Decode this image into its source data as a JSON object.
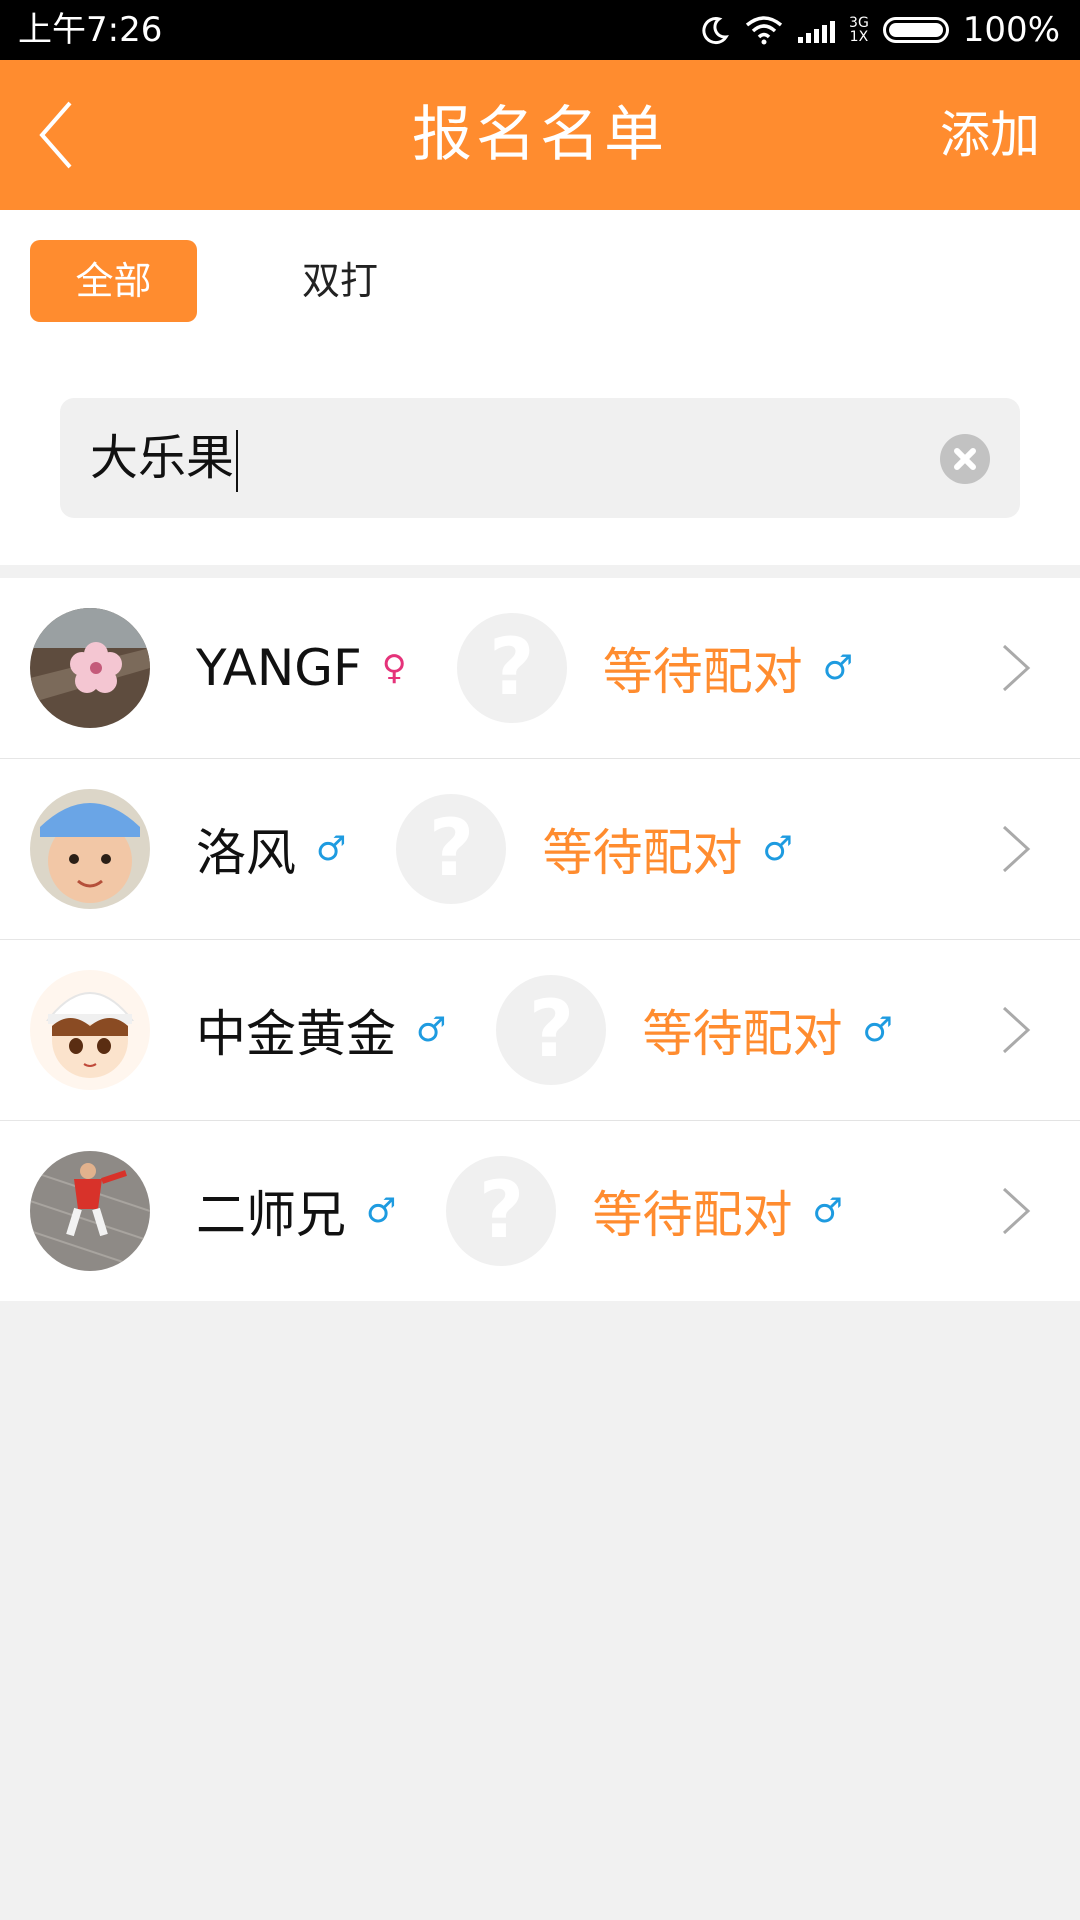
{
  "status_bar": {
    "time": "上午7:26",
    "network_top": "3G",
    "network_bottom": "1X",
    "battery": "100%"
  },
  "app_bar": {
    "title": "报名名单",
    "add_label": "添加",
    "back_icon": "chevron-left-icon",
    "background": "#ff8c2f"
  },
  "filter": {
    "tabs": [
      {
        "label": "全部",
        "selected": true
      },
      {
        "label": "双打",
        "selected": false
      }
    ],
    "search_value": "大乐果"
  },
  "list": {
    "items": [
      {
        "name": "YANGF",
        "gender_symbol": "♀",
        "gender": "female",
        "partner_placeholder": "?",
        "status": "等待配对",
        "partner_gender_symbol": "♂"
      },
      {
        "name": "洛风",
        "gender_symbol": "♂",
        "gender": "male",
        "partner_placeholder": "?",
        "status": "等待配对",
        "partner_gender_symbol": "♂"
      },
      {
        "name": "中金黄金",
        "gender_symbol": "♂",
        "gender": "male",
        "partner_placeholder": "?",
        "status": "等待配对",
        "partner_gender_symbol": "♂"
      },
      {
        "name": "二师兄",
        "gender_symbol": "♂",
        "gender": "male",
        "partner_placeholder": "?",
        "status": "等待配对",
        "partner_gender_symbol": "♂"
      }
    ]
  },
  "colors": {
    "accent": "#ff8c2f",
    "female": "#e5337a",
    "male": "#1e9be0"
  }
}
